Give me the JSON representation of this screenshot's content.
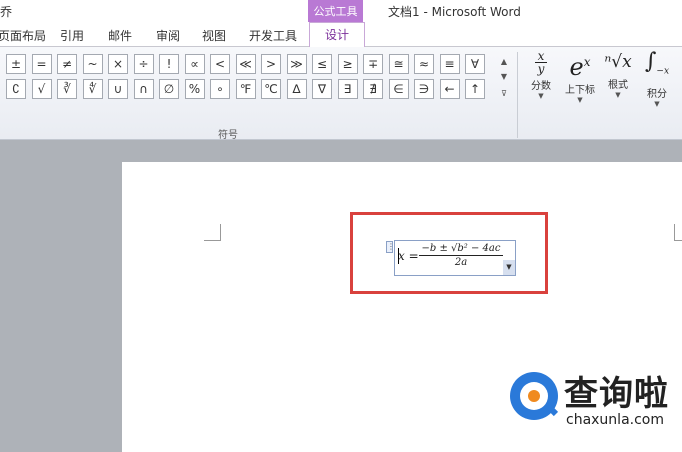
{
  "window": {
    "title": "文档1 - Microsoft Word",
    "left_fragment": "乔"
  },
  "contextual_group": "公式工具",
  "tabs": [
    {
      "label": "页面布局"
    },
    {
      "label": "引用"
    },
    {
      "label": "邮件"
    },
    {
      "label": "审阅"
    },
    {
      "label": "视图"
    },
    {
      "label": "开发工具"
    },
    {
      "label": "设计"
    }
  ],
  "symbols_row1": [
    "±",
    "=",
    "≠",
    "~",
    "×",
    "÷",
    "!",
    "∝",
    "<",
    "≪",
    ">",
    "≫",
    "≤",
    "≥",
    "∓",
    "≅",
    "≈",
    "≡",
    "∀"
  ],
  "symbols_row2": [
    "∁",
    "√",
    "∛",
    "∜",
    "∪",
    "∩",
    "∅",
    "%",
    "∘",
    "℉",
    "℃",
    "∆",
    "∇",
    "∃",
    "∄",
    "∈",
    "∋",
    "←",
    "↑"
  ],
  "group_label": "符号",
  "big_buttons": [
    {
      "glyph_top": "x",
      "glyph_bot": "y",
      "label": "分数"
    },
    {
      "glyph_top": "e",
      "glyph_bot": "x",
      "label": "上下标"
    },
    {
      "glyph_top": "ⁿ√x",
      "glyph_bot": "",
      "label": "根式"
    },
    {
      "glyph_top": "∫",
      "glyph_bot": "−x",
      "label": "积分"
    }
  ],
  "equation": {
    "lhs": "x =",
    "numerator": "−b ± √b² − 4ac",
    "denominator": "2a"
  },
  "watermark": {
    "cn": "查询啦",
    "en": "chaxunla.com"
  },
  "colors": {
    "accent": "#b979d4",
    "highlight": "#d9413d",
    "logo_blue": "#2a79d9",
    "logo_orange": "#f08a1f"
  }
}
